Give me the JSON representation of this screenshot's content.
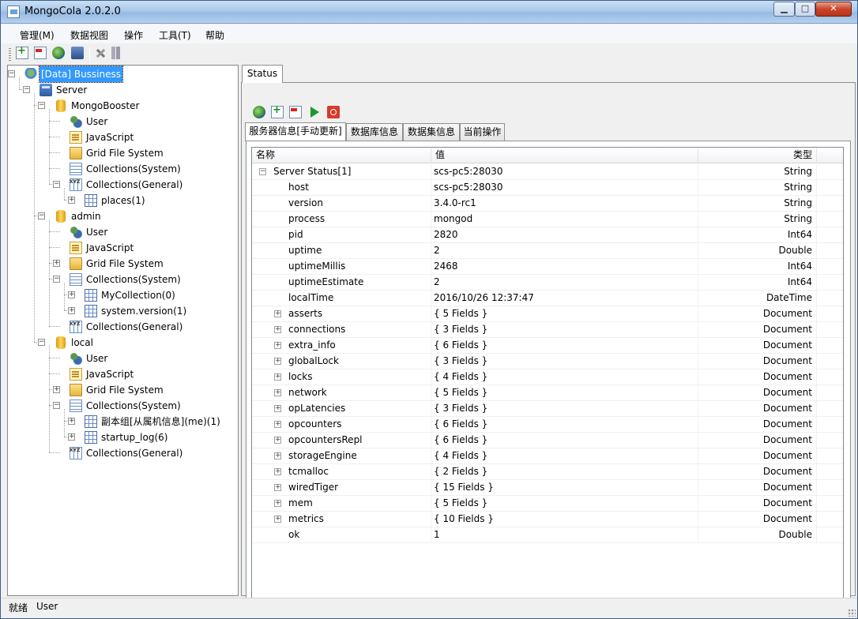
{
  "window": {
    "title": "MongoCola  2.0.2.0",
    "min_glyph": "▁",
    "max_glyph": "□",
    "close_glyph": "✕"
  },
  "menu": [
    "管理(M)",
    "数据视图",
    "操作",
    "工具(T)",
    "帮助"
  ],
  "toolbar_icons": [
    "add-icon",
    "delete-icon",
    "refresh-icon",
    "database-icon",
    "tools-icon",
    "server-icon"
  ],
  "tree": [
    {
      "label": "[Data]  Bussiness",
      "icon": "connection-icon",
      "level": 0,
      "selected": true
    },
    {
      "label": "Server",
      "icon": "server-icon",
      "level": 1
    },
    {
      "label": "MongoBooster",
      "icon": "database-icon",
      "level": 2
    },
    {
      "label": "User",
      "icon": "user-icon",
      "level": 3
    },
    {
      "label": "JavaScript",
      "icon": "javascript-icon",
      "level": 3
    },
    {
      "label": "Grid File System",
      "icon": "folder-icon",
      "level": 3
    },
    {
      "label": "Collections(System)",
      "icon": "collection-system-icon",
      "level": 3
    },
    {
      "label": "Collections(General)",
      "icon": "collection-general-icon",
      "level": 3
    },
    {
      "label": "places(1)",
      "icon": "collection-icon",
      "level": 4
    },
    {
      "label": "admin",
      "icon": "database-icon",
      "level": 2
    },
    {
      "label": "User",
      "icon": "user-icon",
      "level": 3
    },
    {
      "label": "JavaScript",
      "icon": "javascript-icon",
      "level": 3
    },
    {
      "label": "Grid File System",
      "icon": "folder-icon",
      "level": 3
    },
    {
      "label": "Collections(System)",
      "icon": "collection-system-icon",
      "level": 3
    },
    {
      "label": "MyCollection(0)",
      "icon": "collection-icon",
      "level": 4
    },
    {
      "label": "system.version(1)",
      "icon": "collection-icon",
      "level": 4
    },
    {
      "label": "Collections(General)",
      "icon": "collection-general-icon",
      "level": 3
    },
    {
      "label": "local",
      "icon": "database-icon",
      "level": 2
    },
    {
      "label": "User",
      "icon": "user-icon",
      "level": 3
    },
    {
      "label": "JavaScript",
      "icon": "javascript-icon",
      "level": 3
    },
    {
      "label": "Grid File System",
      "icon": "folder-icon",
      "level": 3
    },
    {
      "label": "Collections(System)",
      "icon": "collection-system-icon",
      "level": 3
    },
    {
      "label": "副本组[从属机信息](me)(1)",
      "icon": "collection-icon",
      "level": 4
    },
    {
      "label": "startup_log(6)",
      "icon": "collection-icon",
      "level": 4
    },
    {
      "label": "Collections(General)",
      "icon": "collection-general-icon",
      "level": 3
    }
  ],
  "status_tab": {
    "label": "Status"
  },
  "status_toolbar_icons": [
    "refresh-icon",
    "add-icon",
    "delete-icon",
    "run-icon",
    "stop-icon"
  ],
  "inner_tabs": [
    "服务器信息[手动更新]",
    "数据库信息",
    "数据集信息",
    "当前操作"
  ],
  "grid": {
    "headers": {
      "name": "名称",
      "value": "值",
      "type": "类型"
    },
    "expand_glyph": "+",
    "collapse_glyph": "−",
    "rows": [
      {
        "name": "Server Status[1]",
        "value": "scs-pc5:28030",
        "type": "String",
        "indent": 0,
        "expander": "collapse"
      },
      {
        "name": "host",
        "value": "scs-pc5:28030",
        "type": "String",
        "indent": 1,
        "expander": "none"
      },
      {
        "name": "version",
        "value": "3.4.0-rc1",
        "type": "String",
        "indent": 1,
        "expander": "none"
      },
      {
        "name": "process",
        "value": "mongod",
        "type": "String",
        "indent": 1,
        "expander": "none"
      },
      {
        "name": "pid",
        "value": "2820",
        "type": "Int64",
        "indent": 1,
        "expander": "none"
      },
      {
        "name": "uptime",
        "value": "2",
        "type": "Double",
        "indent": 1,
        "expander": "none"
      },
      {
        "name": "uptimeMillis",
        "value": "2468",
        "type": "Int64",
        "indent": 1,
        "expander": "none"
      },
      {
        "name": "uptimeEstimate",
        "value": "2",
        "type": "Int64",
        "indent": 1,
        "expander": "none"
      },
      {
        "name": "localTime",
        "value": "2016/10/26 12:37:47",
        "type": "DateTime",
        "indent": 1,
        "expander": "none"
      },
      {
        "name": "asserts",
        "value": "{ 5 Fields }",
        "type": "Document",
        "indent": 1,
        "expander": "expand"
      },
      {
        "name": "connections",
        "value": "{ 3 Fields }",
        "type": "Document",
        "indent": 1,
        "expander": "expand"
      },
      {
        "name": "extra_info",
        "value": "{ 6 Fields }",
        "type": "Document",
        "indent": 1,
        "expander": "expand"
      },
      {
        "name": "globalLock",
        "value": "{ 3 Fields }",
        "type": "Document",
        "indent": 1,
        "expander": "expand"
      },
      {
        "name": "locks",
        "value": "{ 4 Fields }",
        "type": "Document",
        "indent": 1,
        "expander": "expand"
      },
      {
        "name": "network",
        "value": "{ 5 Fields }",
        "type": "Document",
        "indent": 1,
        "expander": "expand"
      },
      {
        "name": "opLatencies",
        "value": "{ 3 Fields }",
        "type": "Document",
        "indent": 1,
        "expander": "expand"
      },
      {
        "name": "opcounters",
        "value": "{ 6 Fields }",
        "type": "Document",
        "indent": 1,
        "expander": "expand"
      },
      {
        "name": "opcountersRepl",
        "value": "{ 6 Fields }",
        "type": "Document",
        "indent": 1,
        "expander": "expand"
      },
      {
        "name": "storageEngine",
        "value": "{ 4 Fields }",
        "type": "Document",
        "indent": 1,
        "expander": "expand"
      },
      {
        "name": "tcmalloc",
        "value": "{ 2 Fields }",
        "type": "Document",
        "indent": 1,
        "expander": "expand"
      },
      {
        "name": "wiredTiger",
        "value": "{ 15 Fields }",
        "type": "Document",
        "indent": 1,
        "expander": "expand"
      },
      {
        "name": "mem",
        "value": "{ 5 Fields }",
        "type": "Document",
        "indent": 1,
        "expander": "expand"
      },
      {
        "name": "metrics",
        "value": "{ 10 Fields }",
        "type": "Document",
        "indent": 1,
        "expander": "expand"
      },
      {
        "name": "ok",
        "value": "1",
        "type": "Double",
        "indent": 1,
        "expander": "none"
      }
    ]
  },
  "statusbar": {
    "state": "就绪",
    "user": "User"
  },
  "colors": {
    "selection": "#3399ff",
    "titlebar": "#a9c8ea",
    "close_button": "#c8452a"
  }
}
